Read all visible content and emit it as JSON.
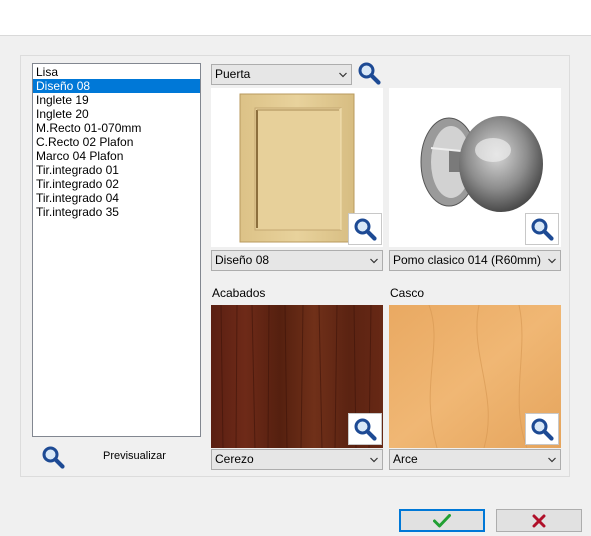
{
  "options_list": {
    "items": [
      "Lisa",
      "Diseño 08",
      "Inglete 19",
      "Inglete 20",
      "M.Recto 01-070mm",
      "C.Recto 02 Plafon",
      "Marco 04 Plafon",
      "Tir.integrado 01",
      "Tir.integrado 02",
      "Tir.integrado 04",
      "Tir.integrado 35"
    ],
    "selected_index": 1
  },
  "preview": {
    "label": "Previsualizar"
  },
  "category_select": {
    "value": "Puerta"
  },
  "door": {
    "select_value": "Diseño 08",
    "icon": "door-panel-image"
  },
  "handle": {
    "select_value": "Pomo clasico 014 (R60mm)",
    "icon": "knob-image"
  },
  "finishes": {
    "label": "Acabados",
    "select_value": "Cerezo",
    "icon": "cherry-wood-texture"
  },
  "carcass": {
    "label": "Casco",
    "select_value": "Arce",
    "icon": "maple-wood-texture"
  },
  "actions": {
    "ok_icon": "check-icon",
    "cancel_icon": "x-icon"
  },
  "colors": {
    "selection": "#0078d7",
    "ok_green": "#22a033",
    "cancel_red": "#b0102a",
    "magnifier_blue": "#1d4a94"
  }
}
